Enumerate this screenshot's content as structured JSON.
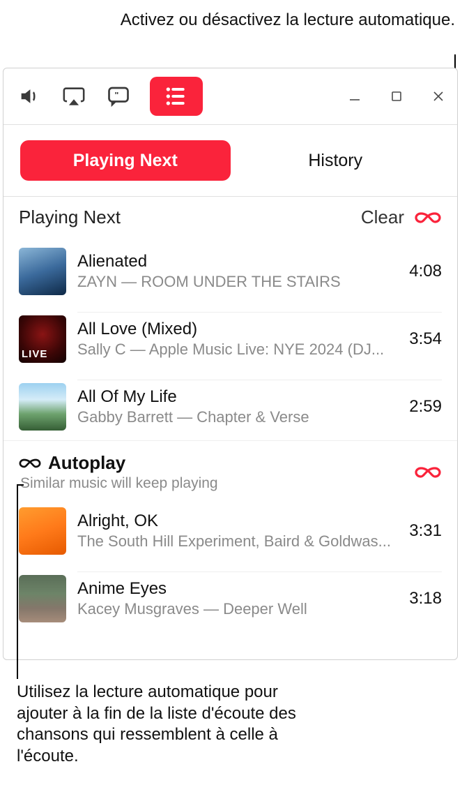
{
  "callouts": {
    "top": "Activez ou désactivez la lecture automatique.",
    "bottom": "Utilisez la lecture automatique pour ajouter à la fin de la liste d'écoute des chansons qui ressemblent à celle à l'écoute."
  },
  "toolbar": {
    "volume_icon": "volume-icon",
    "airplay_icon": "airplay-icon",
    "lyrics_icon": "lyrics-icon",
    "queue_icon": "queue-list-icon"
  },
  "window_controls": {
    "minimize": "minimize-icon",
    "maximize": "maximize-icon",
    "close": "close-icon"
  },
  "tabs": {
    "playing_next": "Playing Next",
    "history": "History"
  },
  "queue_header": {
    "title": "Playing Next",
    "clear": "Clear"
  },
  "tracks": [
    {
      "title": "Alienated",
      "subtitle": "ZAYN — ROOM UNDER THE STAIRS",
      "duration": "4:08"
    },
    {
      "title": "All Love (Mixed)",
      "subtitle": "Sally C — Apple Music Live: NYE 2024 (DJ...",
      "duration": "3:54"
    },
    {
      "title": "All Of My Life",
      "subtitle": "Gabby Barrett — Chapter & Verse",
      "duration": "2:59"
    }
  ],
  "autoplay": {
    "title": "Autoplay",
    "subtitle": "Similar music will keep playing"
  },
  "autoplay_tracks": [
    {
      "title": "Alright, OK",
      "subtitle": "The South Hill Experiment, Baird & Goldwas...",
      "duration": "3:31"
    },
    {
      "title": "Anime Eyes",
      "subtitle": "Kacey Musgraves — Deeper Well",
      "duration": "3:18"
    }
  ]
}
